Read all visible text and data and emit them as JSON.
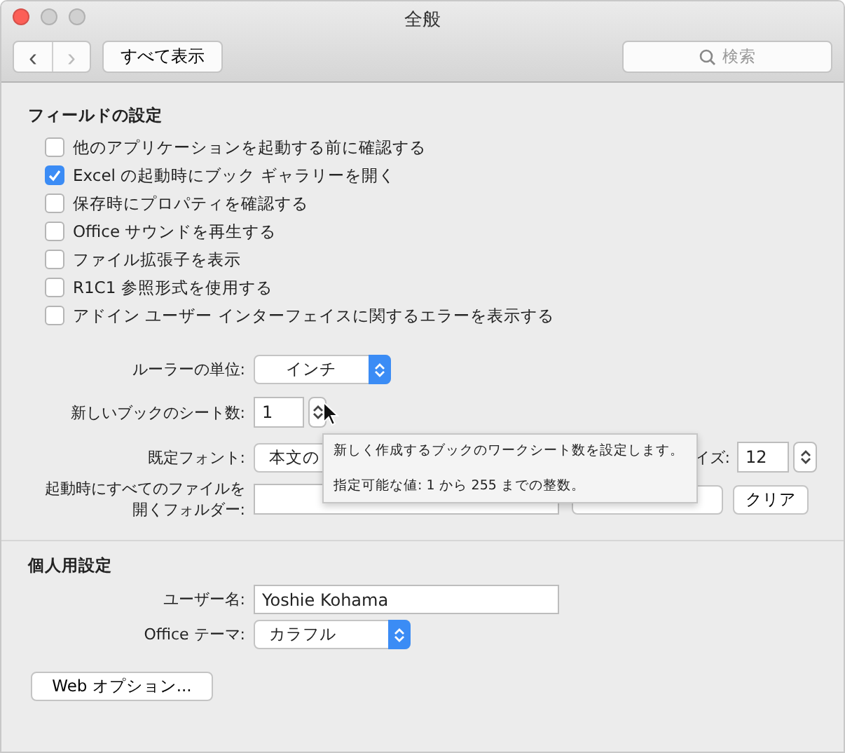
{
  "window": {
    "title": "全般"
  },
  "toolbar": {
    "back": "‹",
    "forward": "›",
    "show_all": "すべて表示",
    "search": {
      "placeholder": "検索"
    }
  },
  "field_settings": {
    "heading": "フィールドの設定",
    "options": [
      {
        "label": "他のアプリケーションを起動する前に確認する",
        "checked": false
      },
      {
        "label": "Excel の起動時にブック ギャラリーを開く",
        "checked": true
      },
      {
        "label": "保存時にプロパティを確認する",
        "checked": false
      },
      {
        "label": "Office サウンドを再生する",
        "checked": false
      },
      {
        "label": "ファイル拡張子を表示",
        "checked": false
      },
      {
        "label": "R1C1 参照形式を使用する",
        "checked": false
      },
      {
        "label": "アドイン ユーザー インターフェイスに関するエラーを表示する",
        "checked": false
      }
    ],
    "ruler_units": {
      "label": "ルーラーの単位:",
      "value": "インチ"
    },
    "sheets": {
      "label": "新しいブックのシート数:",
      "value": "1"
    },
    "default_font": {
      "label": "既定フォント:",
      "value": "本文の",
      "size_label": "イズ:",
      "size": "12"
    },
    "startup_folder": {
      "label_lines": [
        "起動時にすべてのファイルを",
        "開くフォルダー:"
      ],
      "clear": "クリア"
    }
  },
  "tooltip": {
    "lines": [
      "新しく作成するブックのワークシート数を設定します。",
      "指定可能な値: 1 から 255 までの整数。"
    ]
  },
  "personal": {
    "heading": "個人用設定",
    "user_name": {
      "label": "ユーザー名:",
      "value": "Yoshie Kohama"
    },
    "theme": {
      "label": "Office テーマ:",
      "value": "カラフル"
    },
    "web_options": "Web オプション..."
  }
}
